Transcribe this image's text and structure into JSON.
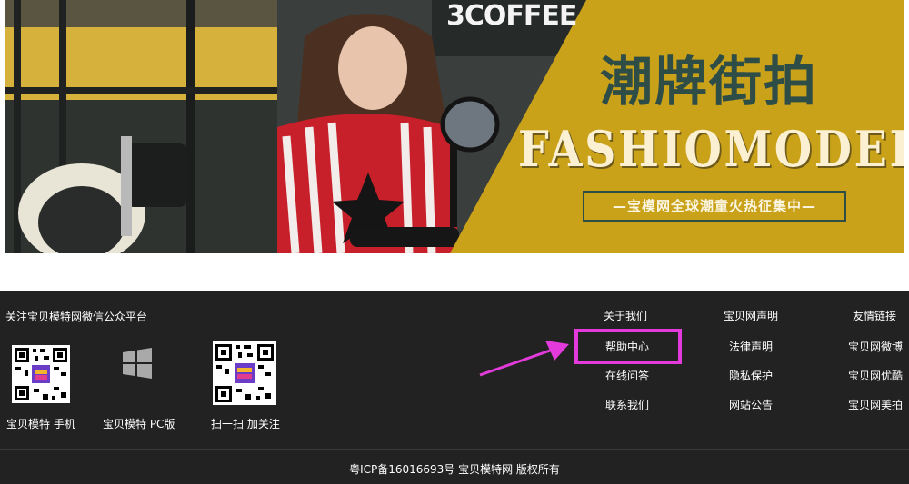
{
  "banner": {
    "brand_text": "3COFFEE",
    "headline_cn": "潮牌街拍",
    "headline_en": "FASHIOMODELS",
    "tagline": "—宝模网全球潮童火热征集中—",
    "colors": {
      "gold": "#c9a21a",
      "teal": "#2f4d47",
      "cream": "#fbf1d2"
    }
  },
  "footer": {
    "follow_title": "关注宝贝模特网微信公众平台",
    "platforms": [
      {
        "label": "宝贝模特 手机",
        "icon": "qr-code-icon"
      },
      {
        "label": "宝贝模特 PC版",
        "icon": "windows-icon"
      },
      {
        "label": "扫一扫 加关注",
        "icon": "qr-code-icon"
      }
    ],
    "columns": [
      {
        "items": [
          "关于我们",
          "帮助中心",
          "在线问答",
          "联系我们"
        ]
      },
      {
        "items": [
          "宝贝网声明",
          "法律声明",
          "隐私保护",
          "网站公告"
        ]
      },
      {
        "items": [
          "友情链接",
          "宝贝网微博",
          "宝贝网优酷",
          "宝贝网美拍"
        ]
      }
    ],
    "highlight_color": "#e33bdb",
    "copyright": "粤ICP备16016693号 宝贝模特网 版权所有"
  }
}
